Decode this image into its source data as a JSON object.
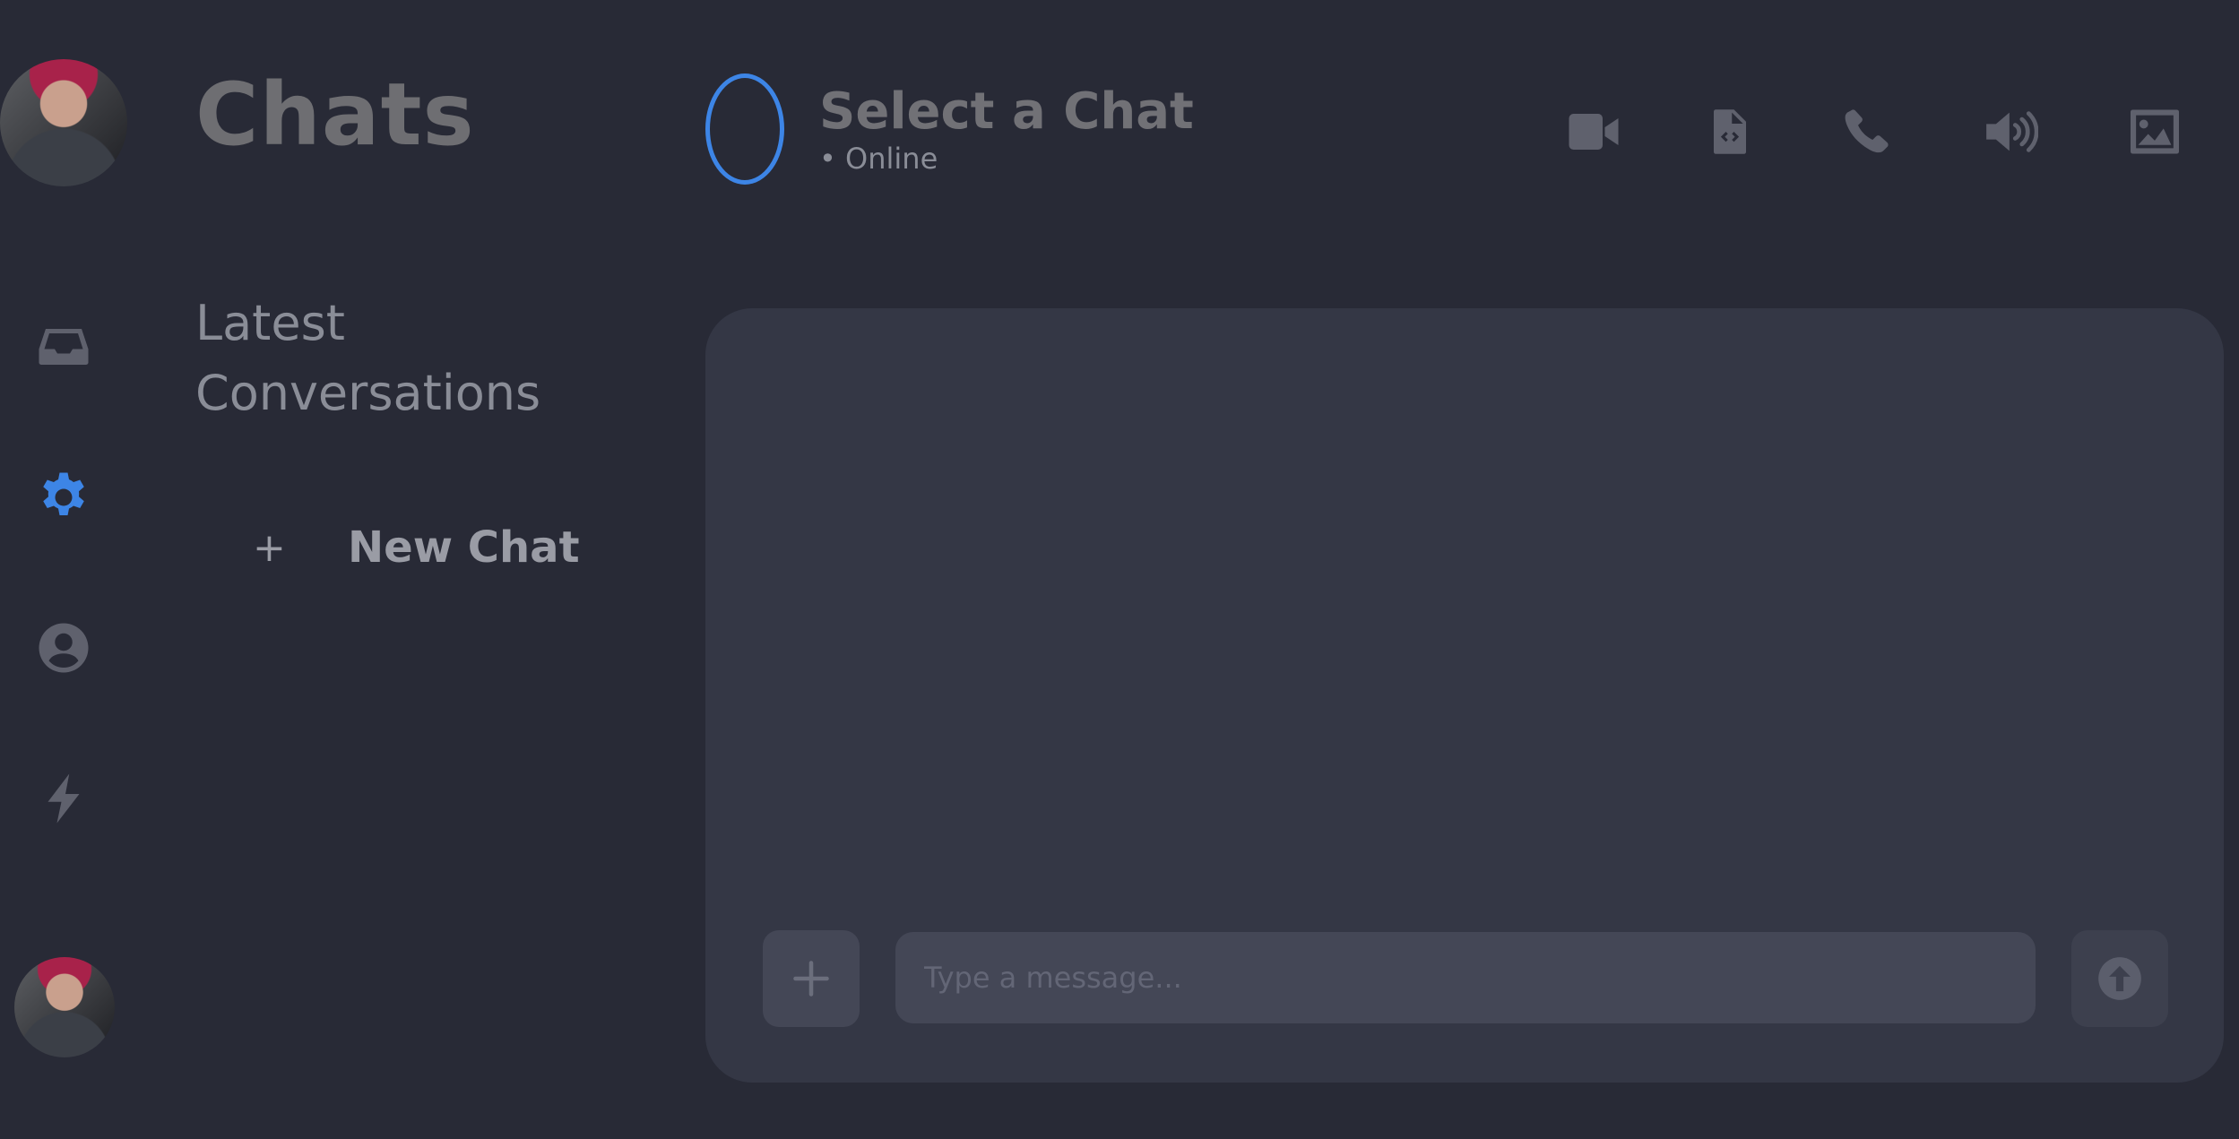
{
  "sidebar": {
    "nav_icons": [
      "inbox-icon",
      "gear-icon",
      "user-circle-icon",
      "bolt-icon"
    ],
    "active_icon": "gear-icon",
    "colors": {
      "icon": "#5f616d",
      "active": "#3d85e6"
    }
  },
  "conversations": {
    "title": "Chats",
    "section_heading": "Latest Conversations",
    "new_chat_symbol": "+",
    "new_chat_label": "New Chat"
  },
  "header": {
    "contact_name": "Select a Chat",
    "status": "• Online",
    "actions": [
      "video-icon",
      "code-file-icon",
      "phone-icon",
      "speaker-icon",
      "image-icon"
    ]
  },
  "composer": {
    "placeholder": "Type a message...",
    "value": ""
  },
  "colors": {
    "background": "#282a36",
    "panel": "#343745",
    "input": "#444756",
    "accent": "#3d85e6"
  }
}
